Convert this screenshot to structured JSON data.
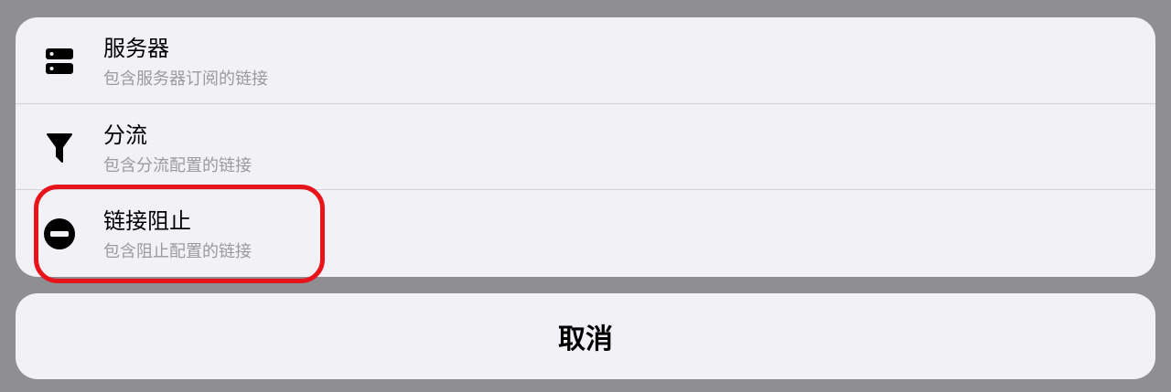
{
  "menu": {
    "items": [
      {
        "icon": "server-icon",
        "title": "服务器",
        "subtitle": "包含服务器订阅的链接"
      },
      {
        "icon": "filter-icon",
        "title": "分流",
        "subtitle": "包含分流配置的链接"
      },
      {
        "icon": "block-icon",
        "title": "链接阻止",
        "subtitle": "包含阻止配置的链接"
      }
    ]
  },
  "cancel_label": "取消",
  "colors": {
    "backdrop": "#8e8e93",
    "sheet": "#f2f2f6",
    "highlight": "#e8141b",
    "subtitle": "#9a9a9f"
  }
}
